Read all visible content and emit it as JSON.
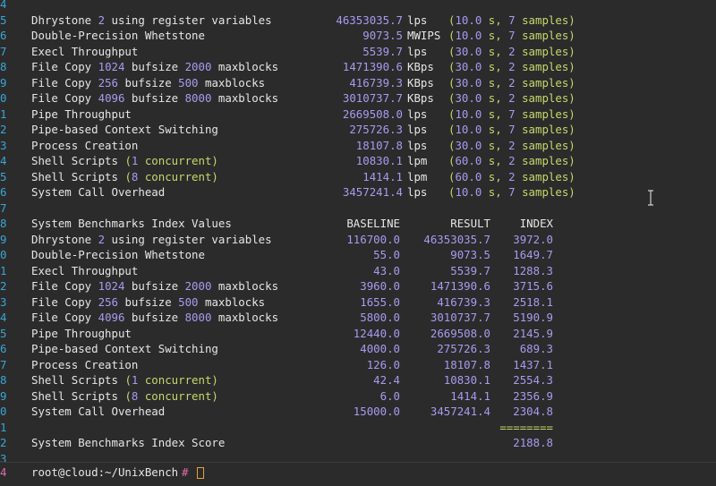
{
  "colors": {
    "background": "#2b2b2b",
    "text": "#e6e6e6",
    "number": "#a99af0",
    "paren": "#c6d76c",
    "gutter": "#3aa6d6",
    "prompt_gutter": "#e26ba6",
    "cursor": "#e6a23c"
  },
  "gutter": [
    "4",
    "5",
    "6",
    "7",
    "8",
    "9",
    "0",
    "1",
    "2",
    "3",
    "4",
    "5",
    "6",
    "7",
    "8",
    "9",
    "0",
    "1",
    "2",
    "3",
    "4",
    "5",
    "6",
    "7",
    "8",
    "9",
    "0",
    "1",
    "2",
    "3",
    "4"
  ],
  "results": {
    "rows": [
      {
        "name_parts": [
          {
            "t": "Dhrystone ",
            "c": "white"
          },
          {
            "t": "2",
            "c": "purple"
          },
          {
            "t": " using register variables",
            "c": "white"
          }
        ],
        "value": "46353035.7",
        "unit": "lps",
        "time": "10.0",
        "samples": "7"
      },
      {
        "name_parts": [
          {
            "t": "Double-Precision Whetstone",
            "c": "white"
          }
        ],
        "value": "9073.5",
        "unit": "MWIPS",
        "time": "10.0",
        "samples": "7"
      },
      {
        "name_parts": [
          {
            "t": "Execl Throughput",
            "c": "white"
          }
        ],
        "value": "5539.7",
        "unit": "lps",
        "time": "30.0",
        "samples": "2"
      },
      {
        "name_parts": [
          {
            "t": "File Copy ",
            "c": "white"
          },
          {
            "t": "1024",
            "c": "purple"
          },
          {
            "t": " bufsize ",
            "c": "white"
          },
          {
            "t": "2000",
            "c": "purple"
          },
          {
            "t": " maxblocks",
            "c": "white"
          }
        ],
        "value": "1471390.6",
        "unit": "KBps",
        "time": "30.0",
        "samples": "2"
      },
      {
        "name_parts": [
          {
            "t": "File Copy ",
            "c": "white"
          },
          {
            "t": "256",
            "c": "purple"
          },
          {
            "t": " bufsize ",
            "c": "white"
          },
          {
            "t": "500",
            "c": "purple"
          },
          {
            "t": " maxblocks",
            "c": "white"
          }
        ],
        "value": "416739.3",
        "unit": "KBps",
        "time": "30.0",
        "samples": "2"
      },
      {
        "name_parts": [
          {
            "t": "File Copy ",
            "c": "white"
          },
          {
            "t": "4096",
            "c": "purple"
          },
          {
            "t": " bufsize ",
            "c": "white"
          },
          {
            "t": "8000",
            "c": "purple"
          },
          {
            "t": " maxblocks",
            "c": "white"
          }
        ],
        "value": "3010737.7",
        "unit": "KBps",
        "time": "30.0",
        "samples": "2"
      },
      {
        "name_parts": [
          {
            "t": "Pipe Throughput",
            "c": "white"
          }
        ],
        "value": "2669508.0",
        "unit": "lps",
        "time": "10.0",
        "samples": "7"
      },
      {
        "name_parts": [
          {
            "t": "Pipe-based Context Switching",
            "c": "white"
          }
        ],
        "value": "275726.3",
        "unit": "lps",
        "time": "10.0",
        "samples": "7"
      },
      {
        "name_parts": [
          {
            "t": "Process Creation",
            "c": "white"
          }
        ],
        "value": "18107.8",
        "unit": "lps",
        "time": "30.0",
        "samples": "2"
      },
      {
        "name_parts": [
          {
            "t": "Shell Scripts ",
            "c": "white"
          },
          {
            "t": "(",
            "c": "green"
          },
          {
            "t": "1",
            "c": "purple"
          },
          {
            "t": " concurrent)",
            "c": "green"
          }
        ],
        "value": "10830.1",
        "unit": "lpm",
        "time": "60.0",
        "samples": "2"
      },
      {
        "name_parts": [
          {
            "t": "Shell Scripts ",
            "c": "white"
          },
          {
            "t": "(",
            "c": "green"
          },
          {
            "t": "8",
            "c": "purple"
          },
          {
            "t": " concurrent)",
            "c": "green"
          }
        ],
        "value": "1414.1",
        "unit": "lpm",
        "time": "60.0",
        "samples": "2"
      },
      {
        "name_parts": [
          {
            "t": "System Call Overhead",
            "c": "white"
          }
        ],
        "value": "3457241.4",
        "unit": "lps",
        "time": "10.0",
        "samples": "7"
      }
    ]
  },
  "index": {
    "header": {
      "title": "System Benchmarks Index Values",
      "baseline": "BASELINE",
      "result": "RESULT",
      "index": "INDEX"
    },
    "rows": [
      {
        "name_parts": [
          {
            "t": "Dhrystone ",
            "c": "white"
          },
          {
            "t": "2",
            "c": "purple"
          },
          {
            "t": " using register variables",
            "c": "white"
          }
        ],
        "baseline": "116700.0",
        "result": "46353035.7",
        "index": "3972.0"
      },
      {
        "name_parts": [
          {
            "t": "Double-Precision Whetstone",
            "c": "white"
          }
        ],
        "baseline": "55.0",
        "result": "9073.5",
        "index": "1649.7"
      },
      {
        "name_parts": [
          {
            "t": "Execl Throughput",
            "c": "white"
          }
        ],
        "baseline": "43.0",
        "result": "5539.7",
        "index": "1288.3"
      },
      {
        "name_parts": [
          {
            "t": "File Copy ",
            "c": "white"
          },
          {
            "t": "1024",
            "c": "purple"
          },
          {
            "t": " bufsize ",
            "c": "white"
          },
          {
            "t": "2000",
            "c": "purple"
          },
          {
            "t": " maxblocks",
            "c": "white"
          }
        ],
        "baseline": "3960.0",
        "result": "1471390.6",
        "index": "3715.6"
      },
      {
        "name_parts": [
          {
            "t": "File Copy ",
            "c": "white"
          },
          {
            "t": "256",
            "c": "purple"
          },
          {
            "t": " bufsize ",
            "c": "white"
          },
          {
            "t": "500",
            "c": "purple"
          },
          {
            "t": " maxblocks",
            "c": "white"
          }
        ],
        "baseline": "1655.0",
        "result": "416739.3",
        "index": "2518.1"
      },
      {
        "name_parts": [
          {
            "t": "File Copy ",
            "c": "white"
          },
          {
            "t": "4096",
            "c": "purple"
          },
          {
            "t": " bufsize ",
            "c": "white"
          },
          {
            "t": "8000",
            "c": "purple"
          },
          {
            "t": " maxblocks",
            "c": "white"
          }
        ],
        "baseline": "5800.0",
        "result": "3010737.7",
        "index": "5190.9"
      },
      {
        "name_parts": [
          {
            "t": "Pipe Throughput",
            "c": "white"
          }
        ],
        "baseline": "12440.0",
        "result": "2669508.0",
        "index": "2145.9"
      },
      {
        "name_parts": [
          {
            "t": "Pipe-based Context Switching",
            "c": "white"
          }
        ],
        "baseline": "4000.0",
        "result": "275726.3",
        "index": "689.3"
      },
      {
        "name_parts": [
          {
            "t": "Process Creation",
            "c": "white"
          }
        ],
        "baseline": "126.0",
        "result": "18107.8",
        "index": "1437.1"
      },
      {
        "name_parts": [
          {
            "t": "Shell Scripts ",
            "c": "white"
          },
          {
            "t": "(",
            "c": "green"
          },
          {
            "t": "1",
            "c": "purple"
          },
          {
            "t": " concurrent)",
            "c": "green"
          }
        ],
        "baseline": "42.4",
        "result": "10830.1",
        "index": "2554.3"
      },
      {
        "name_parts": [
          {
            "t": "Shell Scripts ",
            "c": "white"
          },
          {
            "t": "(",
            "c": "green"
          },
          {
            "t": "8",
            "c": "purple"
          },
          {
            "t": " concurrent)",
            "c": "green"
          }
        ],
        "baseline": "6.0",
        "result": "1414.1",
        "index": "2356.9"
      },
      {
        "name_parts": [
          {
            "t": "System Call Overhead",
            "c": "white"
          }
        ],
        "baseline": "15000.0",
        "result": "3457241.4",
        "index": "2304.8"
      }
    ],
    "separator": "========",
    "score_label": "System Benchmarks Index Score",
    "score": "2188.8"
  },
  "prompt": {
    "user_host": "root@cloud:~/UnixBench",
    "symbol": "#"
  }
}
